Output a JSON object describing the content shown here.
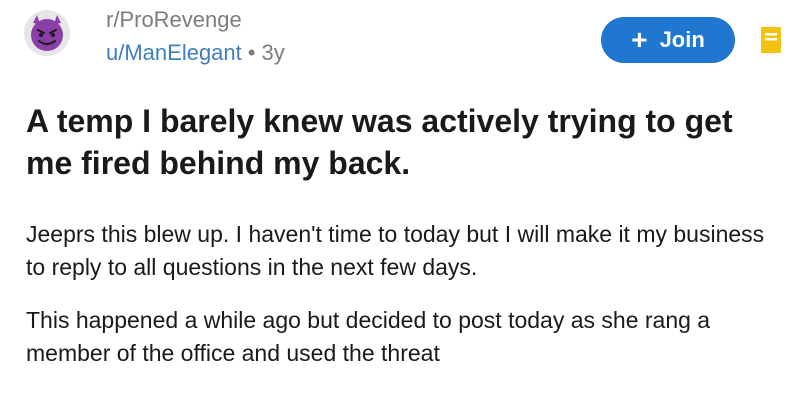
{
  "post": {
    "subreddit": "r/ProRevenge",
    "author": "u/ManElegant",
    "separator": "•",
    "age": "3y",
    "title": "A temp I barely knew was actively trying to get me fired behind my back.",
    "paragraphs": [
      "Jeeprs this blew up. I haven't time to today but I will make it my business to reply to all questions in the next few days.",
      "This happened a while ago but decided to post today as she rang a member of the office and used the threat"
    ]
  },
  "actions": {
    "join_label": "Join",
    "join_plus": "+"
  },
  "icons": {
    "avatar": "devil-emoji-icon",
    "join": "plus-icon",
    "save": "bookmark-icon"
  },
  "colors": {
    "accent": "#1f77d0",
    "username": "#3f7fbf",
    "muted": "#7c7c7c",
    "avatar_face": "#8a3fa8",
    "save_icon": "#f2c30f"
  }
}
